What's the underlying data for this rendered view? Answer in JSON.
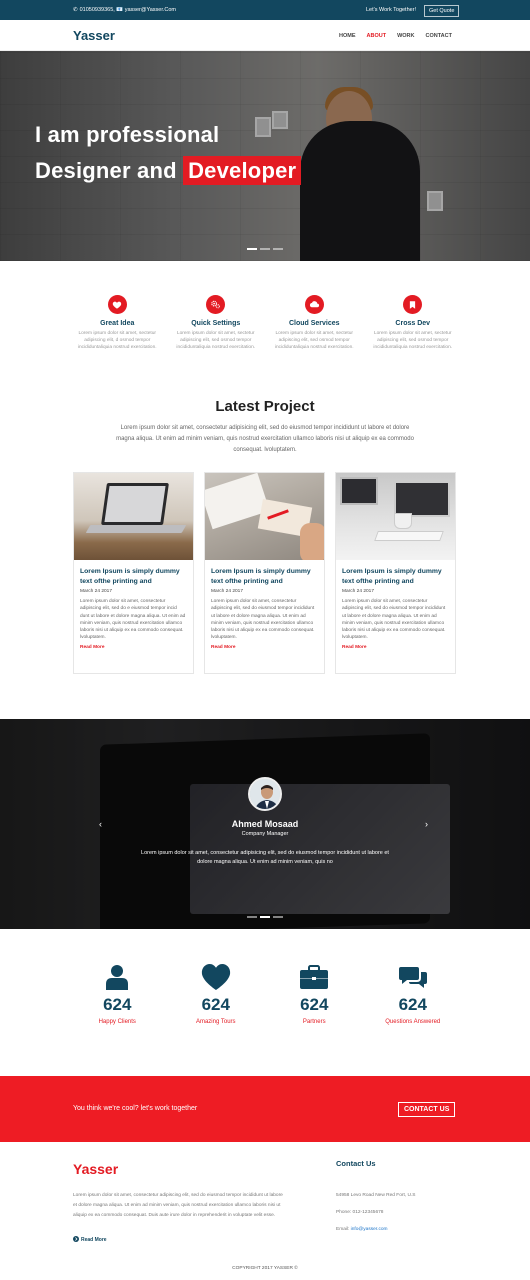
{
  "topbar": {
    "contact": "01050939365, 📧 yasser@Yasser.Com",
    "tagline": "Let's Work Together!",
    "quote_button": "Get Quote"
  },
  "nav": {
    "logo": "Yasser",
    "links": [
      "HOME",
      "ABOUT",
      "WORK",
      "CONTACT"
    ],
    "active": "ABOUT"
  },
  "hero": {
    "line1": "I am professional",
    "line2_prefix": "Designer and",
    "line2_highlight": "Developer"
  },
  "features": [
    {
      "icon": "heart-icon",
      "title": "Great Idea",
      "text": "Lorem ipsum dolor sit amet, sectetur adipiscing elit, d osmod tempor incididuntaliquia nostrud exercitation."
    },
    {
      "icon": "gears-icon",
      "title": "Quick Settings",
      "text": "Lorem ipsum dolor sit amet, sectetur adipiscing elit, sed osmod tempor incididuntaliquia nostrud exercitation."
    },
    {
      "icon": "cloud-icon",
      "title": "Cloud Services",
      "text": "Lorem ipsum dolor sit amet, sectetur adipiscing elit, sed osmod tempor incididuntaliquia nostrud exercitation."
    },
    {
      "icon": "bookmark-icon",
      "title": "Cross Dev",
      "text": "Lorem ipsum dolor sit amet, sectetur adipiscing elit, sed osmod tempor incididuntaliquia nostrud exercitation."
    }
  ],
  "latest": {
    "title": "Latest Project",
    "subtitle": "Lorem ipsum dolor sit amet, consectetur adipisicing elit, sed do eiusmod tempor incididunt ut labore et dolore magna aliqua. Ut enim ad minim veniam, quis nostrud exercitation ullamco laboris nisi ut aliquip ex ea commodo consequat. lvoluptatem.",
    "cards": [
      {
        "title": "Lorem Ipsum is simply dummy text ofthe printing and",
        "date": "March 24 2017",
        "text": "Lorem ipsum dolor sit amet, consectetur adipiscing elit, sed do e eiusmod tempor incid dunt ut labore et dolore magna aliqua. Ut enim ad minim veniam, quis nostrud exercitation ullamco laboris nisi ut aliquip ex ea commodo consequat. lvoluptatem.",
        "more": "Read More"
      },
      {
        "title": "Lorem Ipsum is simply dummy text ofthe printing and",
        "date": "March 24 2017",
        "text": "Lorem ipsum dolor sit amet, consectetur adipiscing elit, sed do eiusmod tempor incididunt ut labore et dolore magna aliqua. Ut enim ad minim veniam, quis nostrud exercitation ullamco laboris nisi ut aliquip ex ea commodo consequat. lvoluptatem.",
        "more": "Read More"
      },
      {
        "title": "Lorem Ipsum is simply dummy text ofthe printing and",
        "date": "March 24 2017",
        "text": "Lorem ipsum dolor sit amet, consectetur adipiscing elit, sed do eiusmod tempor incididunt ut labore et dolore magna aliqua. Ut enim ad minim veniam, quis nostrud exercitation ullamco laboris nisi ut aliquip ex ea commodo consequat. lvoluptatem.",
        "more": "Read More"
      }
    ]
  },
  "testimonial": {
    "name": "Ahmed Mosaad",
    "role": "Company Manager",
    "quote": "Lorem ipsum dolor sit amet, consectetur adipisicing elit, sed do eiusmod tempor incididunt ut labore et dolore magna aliqua. Ut enim ad minim veniam, quis no",
    "prev": "‹",
    "next": "›"
  },
  "stats": [
    {
      "icon": "user-icon",
      "value": "624",
      "label": "Happy Clients"
    },
    {
      "icon": "heart-icon",
      "value": "624",
      "label": "Amazing Tours"
    },
    {
      "icon": "briefcase-icon",
      "value": "624",
      "label": "Partners"
    },
    {
      "icon": "chat-bubbles-icon",
      "value": "624",
      "label": "Questions Answered"
    }
  ],
  "cta": {
    "text": "You think we're cool? let's work together",
    "button": "CONTACT US"
  },
  "footer": {
    "logo": "Yasser",
    "text": "Lorem ipsum dolor sit amet, consectetur adipiscing elit, sed do eiusmod tempor incididunt ut labore et dolore magna aliqua. Ut enim ad minim veniam, quis nostrud exercitation ullamco laboris nisi ut aliquip ex ea commodo consequat. Duis aute irure dolor in reprehenderit in voluptate velit esse.",
    "more": "Read More",
    "contact_title": "Contact Us",
    "address": "54958 Levo Road New Red Fort, U.S",
    "phone": "Phone: 012-12345678",
    "email_label": "Email:",
    "email": "info@yasser.com",
    "copyright": "COPYRIGHT 2017 YASSER ©"
  },
  "colors": {
    "brand_navy": "#12475f",
    "accent_red": "#e31b23",
    "cta_red": "#ee1c24"
  }
}
